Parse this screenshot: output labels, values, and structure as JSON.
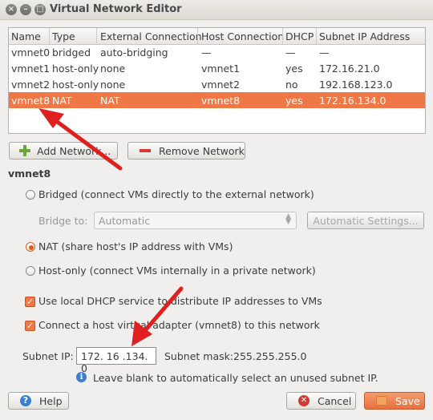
{
  "window": {
    "title": "Virtual Network Editor"
  },
  "table": {
    "columns": [
      "Name",
      "Type",
      "External Connection",
      "Host Connection",
      "DHCP",
      "Subnet IP Address"
    ],
    "rows": [
      [
        "vmnet0",
        "bridged",
        "auto-bridging",
        "—",
        "—",
        "—"
      ],
      [
        "vmnet1",
        "host-only",
        "none",
        "vmnet1",
        "yes",
        "172.16.21.0"
      ],
      [
        "vmnet2",
        "host-only",
        "none",
        "vmnet2",
        "no",
        "192.168.123.0"
      ],
      [
        "vmnet8",
        "NAT",
        "NAT",
        "vmnet8",
        "yes",
        "172.16.134.0"
      ]
    ],
    "selected_row": 3
  },
  "buttons": {
    "add_network": "Add Network...",
    "remove_network": "Remove Network",
    "help": "Help",
    "cancel": "Cancel",
    "save": "Save",
    "automatic_settings": "Automatic Settings..."
  },
  "settings": {
    "section_title": "vmnet8",
    "bridged_label": "Bridged (connect VMs directly to the external network)",
    "bridge_to_label": "Bridge to:",
    "bridge_to_value": "Automatic",
    "nat_label": "NAT (share host's IP address with VMs)",
    "hostonly_label": "Host-only (connect VMs internally in a private network)",
    "dhcp_label": "Use local DHCP service to distribute IP addresses to VMs",
    "adapter_label": "Connect a host virtual adapter (vmnet8) to this network",
    "subnet_ip_label": "Subnet IP:",
    "subnet_ip_value": "172. 16 .134.  0",
    "subnet_mask_label": "Subnet mask:",
    "subnet_mask_value": "255.255.255.0",
    "hint": "Leave blank to automatically select an unused subnet IP.",
    "selected_mode": "nat",
    "dhcp_checked": true,
    "adapter_checked": true
  },
  "colors": {
    "accent": "#f07746",
    "arrow": "#e02020"
  }
}
